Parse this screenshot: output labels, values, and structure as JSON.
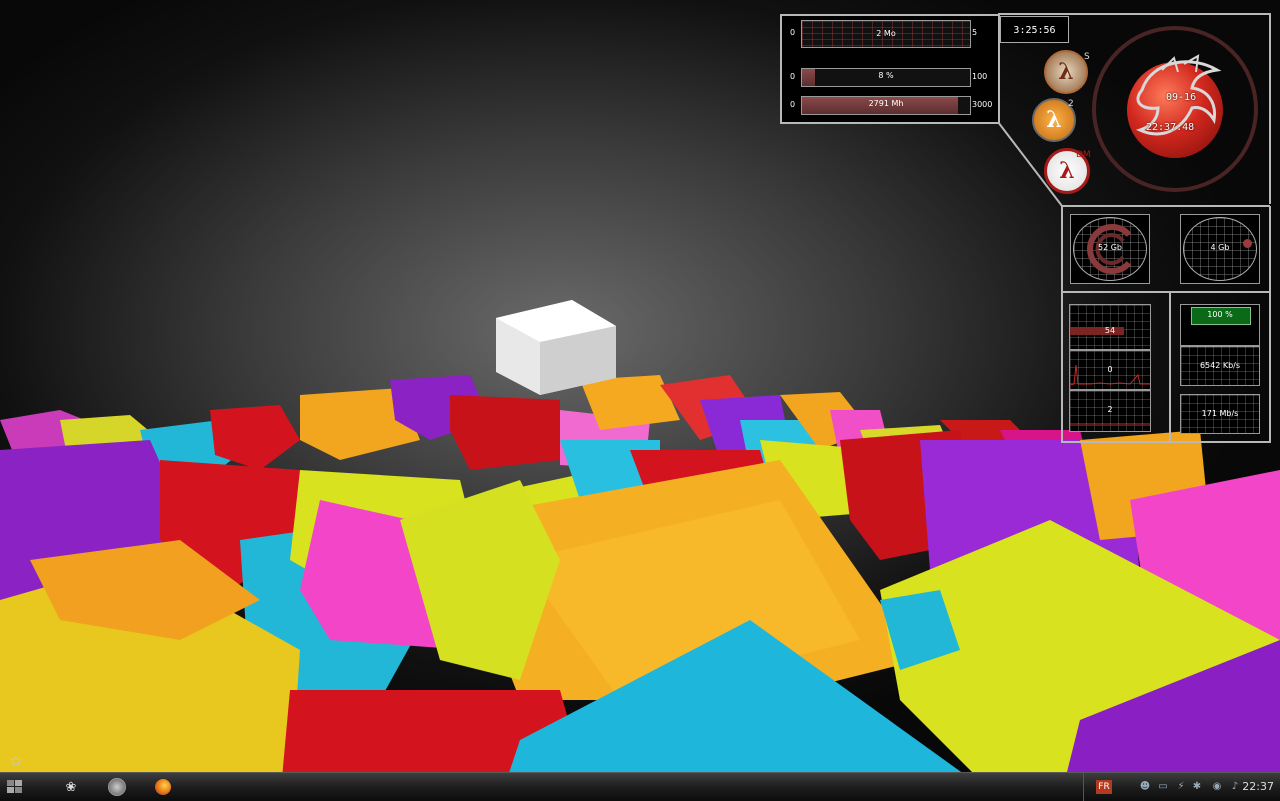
{
  "bars": [
    {
      "min": "0",
      "max": "5",
      "text": "2 Mo",
      "fill": 0.4
    },
    {
      "min": "0",
      "max": "100",
      "text": "8 %",
      "fill": 0.08
    },
    {
      "min": "0",
      "max": "3000",
      "text": "2791 Mh",
      "fill": 0.93
    }
  ],
  "uptime_clock": "3:25:56",
  "orb": {
    "date": "09-16",
    "time": "22:37:48"
  },
  "launchers": [
    {
      "name": "half-life-source",
      "sup": "S"
    },
    {
      "name": "half-life-2",
      "sup": "2"
    },
    {
      "name": "half-life-dm",
      "sup": "DM"
    }
  ],
  "disks": [
    {
      "label": "52 Gb",
      "used": 0.8
    },
    {
      "label": "4 Gb",
      "used": 0.05
    }
  ],
  "graphs": [
    {
      "value": "54"
    },
    {
      "value": "0"
    },
    {
      "value": "2"
    }
  ],
  "network": {
    "percent": "100 %",
    "down": "6542 Kb/s",
    "up": "171 Mb/s"
  },
  "taskbar": {
    "lang": "FR",
    "clock": "22:37"
  },
  "icons": {
    "start": "windows-logo-icon",
    "quicklaunch": [
      "desktop-icon",
      "media-player-icon",
      "firefox-icon"
    ]
  },
  "colors": {
    "widget_red": "#8a4a4a",
    "orb_red": "#d1281e",
    "net_green": "#0a6a18"
  }
}
